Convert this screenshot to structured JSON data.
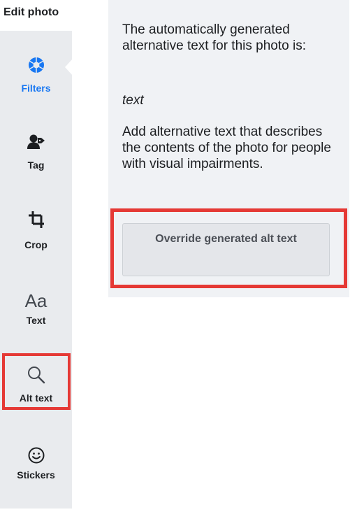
{
  "header": {
    "title": "Edit photo"
  },
  "sidebar": {
    "items": [
      {
        "label": "Filters",
        "icon": "filters-icon",
        "active": true
      },
      {
        "label": "Tag",
        "icon": "tag-person-icon",
        "active": false
      },
      {
        "label": "Crop",
        "icon": "crop-icon",
        "active": false
      },
      {
        "label": "Text",
        "icon": "text-aa-icon",
        "glyph": "Aa",
        "active": false
      },
      {
        "label": "Alt text",
        "icon": "magnifier-icon",
        "active": false,
        "highlighted": true
      },
      {
        "label": "Stickers",
        "icon": "smiley-icon",
        "active": false
      }
    ]
  },
  "panel": {
    "generated_intro": "The automatically generated alternative text for this photo is:",
    "generated_value": "text",
    "instructions": "Add alternative text that describes the contents of the photo for people with visual impairments.",
    "override_button_label": "Override generated alt text"
  },
  "colors": {
    "accent": "#1877f2",
    "highlight": "#e53935",
    "sidebar_bg": "#e9ebee",
    "panel_bg": "#f0f2f5"
  }
}
